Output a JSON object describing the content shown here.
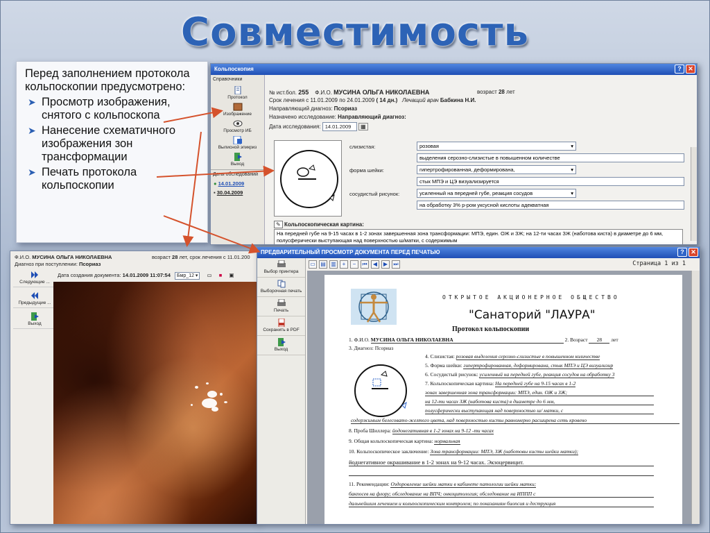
{
  "slide": {
    "title": "Совместимость",
    "note": {
      "intro": "Перед заполнением протокола кольпоскопии предусмотрено:",
      "items": [
        "Просмотр изображения, снятого с кольпоскопа",
        "Нанесение схематичного изображения зон трансформации",
        "Печать протокола кольпоскопии"
      ]
    }
  },
  "colposcopy_window": {
    "title": "Кольпоскопия",
    "sidebar_header": "Справочники",
    "buttons": [
      "Протокол",
      "Изображение",
      "Просмотр ИБ",
      "Выписной эпикриз",
      "Выход"
    ],
    "dates_label": "Даты обследований",
    "dates": [
      "14.01.2009",
      "30.04.2009"
    ],
    "hist_label": "№ ист.бол.",
    "hist_no": "255",
    "fio_label": "Ф.И.О.",
    "fio": "МУСИНА ОЛЬГА НИКОЛАЕВНА",
    "age_label": "возраст",
    "age": "28",
    "age_unit": "лет",
    "treatment": "Срок лечения с 11.01.2009 по 24.01.2009",
    "days": "( 14 дн.)",
    "doctor_label": "Лечащий врач",
    "doctor": "Бабкина Н.И.",
    "ref_diag_label": "Направляющий диагноз:",
    "ref_diag": "Псориаз",
    "assigned_label": "Назначено исследование:",
    "assigned": "Направляющий диагноз:",
    "date_label": "Дата исследования:",
    "date": "14.01.2009",
    "mucosa_label": "слизистая:",
    "mucosa_value": "розовая",
    "mucosa_extra": "выделения серозно-слизистые в повышенном количестве",
    "cervix_label": "форма шейки:",
    "cervix_value": "гипертрофированная, деформирована,",
    "cervix_extra": "стык МПЭ и ЦЭ визуализируется",
    "vessels_label": "сосудистый рисунок:",
    "vessels_value": "усиленный на передней губе, реакция сосудов",
    "vessels_extra": "на обработку 3% р-ром уксусной кислоты адекватная",
    "kartina_label": "Кольпоскопическая картина:",
    "kartina_text": "На передней губе на 9-15 часах в 1-2 зонах  завершенная зона трансформации: МПЭ, един. ОЖ и ЗЖ;  на 12-ти часах ЗЖ (наботова киста) в диаметре до 6 мм, полусферически выступающая над поверхностью ш/матки, с содержимым"
  },
  "image_window": {
    "fio_label": "Ф.И.О.",
    "fio": "МУСИНА ОЛЬГА НИКОЛАЕВНА",
    "age_label": "возраст",
    "age": "28",
    "age_rest": "лет, срок лечения с 11.01.200",
    "diag_label": "Диагноз при поступлении:",
    "diag": "Псориаз",
    "buttons": [
      "Следующие ...",
      "Предыдущие ...",
      "Выход"
    ],
    "doc_date_label": "Дата создания документа:",
    "doc_date": "14.01.2009 11:07:54",
    "file": "Бмр_12"
  },
  "preview_window": {
    "title": "ПРЕДВАРИТЕЛЬНЫЙ ПРОСМОТР ДОКУМЕНТА ПЕРЕД ПЕЧАТЬЮ",
    "buttons": [
      "Выбор принтера",
      "Выборочная печать",
      "Печать",
      "Сохранить в PDF",
      "Выход"
    ],
    "page_info": "Страница  1  из  1",
    "doc": {
      "org_type": "ОТКРЫТОЕ АКЦИОНЕРНОЕ ОБЩЕСТВО",
      "org_name": "\"Санаторий \"ЛАУРА\"",
      "protocol_title": "Протокол кольпоскопии",
      "f1_label": "1. Ф.И.О.",
      "f1_value": "МУСИНА ОЛЬГА НИКОЛАЕВНА",
      "f2_label": "2. Возраст",
      "f2_value": "28",
      "f2_unit": "лет",
      "f3_label": "3. Диагноз:",
      "f3_value": "Псориаз",
      "f4_label": "4. Слизистая:",
      "f4_value": "розовая выделения серозно-слизистые в повышенном количестве",
      "f5_label": "5. Форма шейки:",
      "f5_value": "гипертрофированная, деформирована, стык МПЭ и ЦЭ визуализир",
      "f6_label": "6. Сосудистый рисунок:",
      "f6_value": "усиленный на передней губе, реакция сосудов на обработку 3",
      "f7_label": "7. Кольпоскопическая картина:",
      "f7_lines": [
        "На передней губе на 9-15 часах в 1-2",
        "зонах  завершенная зона трансформации: МПЭ, един. ОЖ и ЗЖ;",
        "на 12-ти часах ЗЖ (наботова киста) в диаметре до 6 мм,",
        "полусферически выступающая над поверхностью ш/ матки, с",
        "содержимым белесовато-желтого цвета, над поверхностью кисты равномерно расширена сеть кровено"
      ],
      "f8_label": "8. Проба Шиллера:",
      "f8_value": "йодонегативная в 1-2 зонах на 9-12 -ти часах",
      "f9_label": "9. Общая кольпоскопическая картина:",
      "f9_value": "нормальная",
      "f10_label": "10. Кольпоскопическое заключение:",
      "f10_value": "Зона трансформации: МПЭ, ЗЖ (наботовы кисты шейки матки);",
      "f10_line2": "йоднегативное окрашивание в 1-2 зонах на 9-12 часах. Экзоцервицит.",
      "f11_label": "11. Рекомендации:",
      "f11_lines": [
        "Оздоровление шейки матки в кабинете патологии шейки матки;",
        "бакпосев на флору; обследование на ВПЧ; онкоцитология; обследование на ИППП с",
        "дальнейшим лечением и кольпоскопическим контролем; по показаниям биопсия и деструкция"
      ]
    }
  },
  "colors": {
    "title_blue": "#2d63b6",
    "window_title": "#1f4fb5",
    "arrow": "#d5522c"
  }
}
